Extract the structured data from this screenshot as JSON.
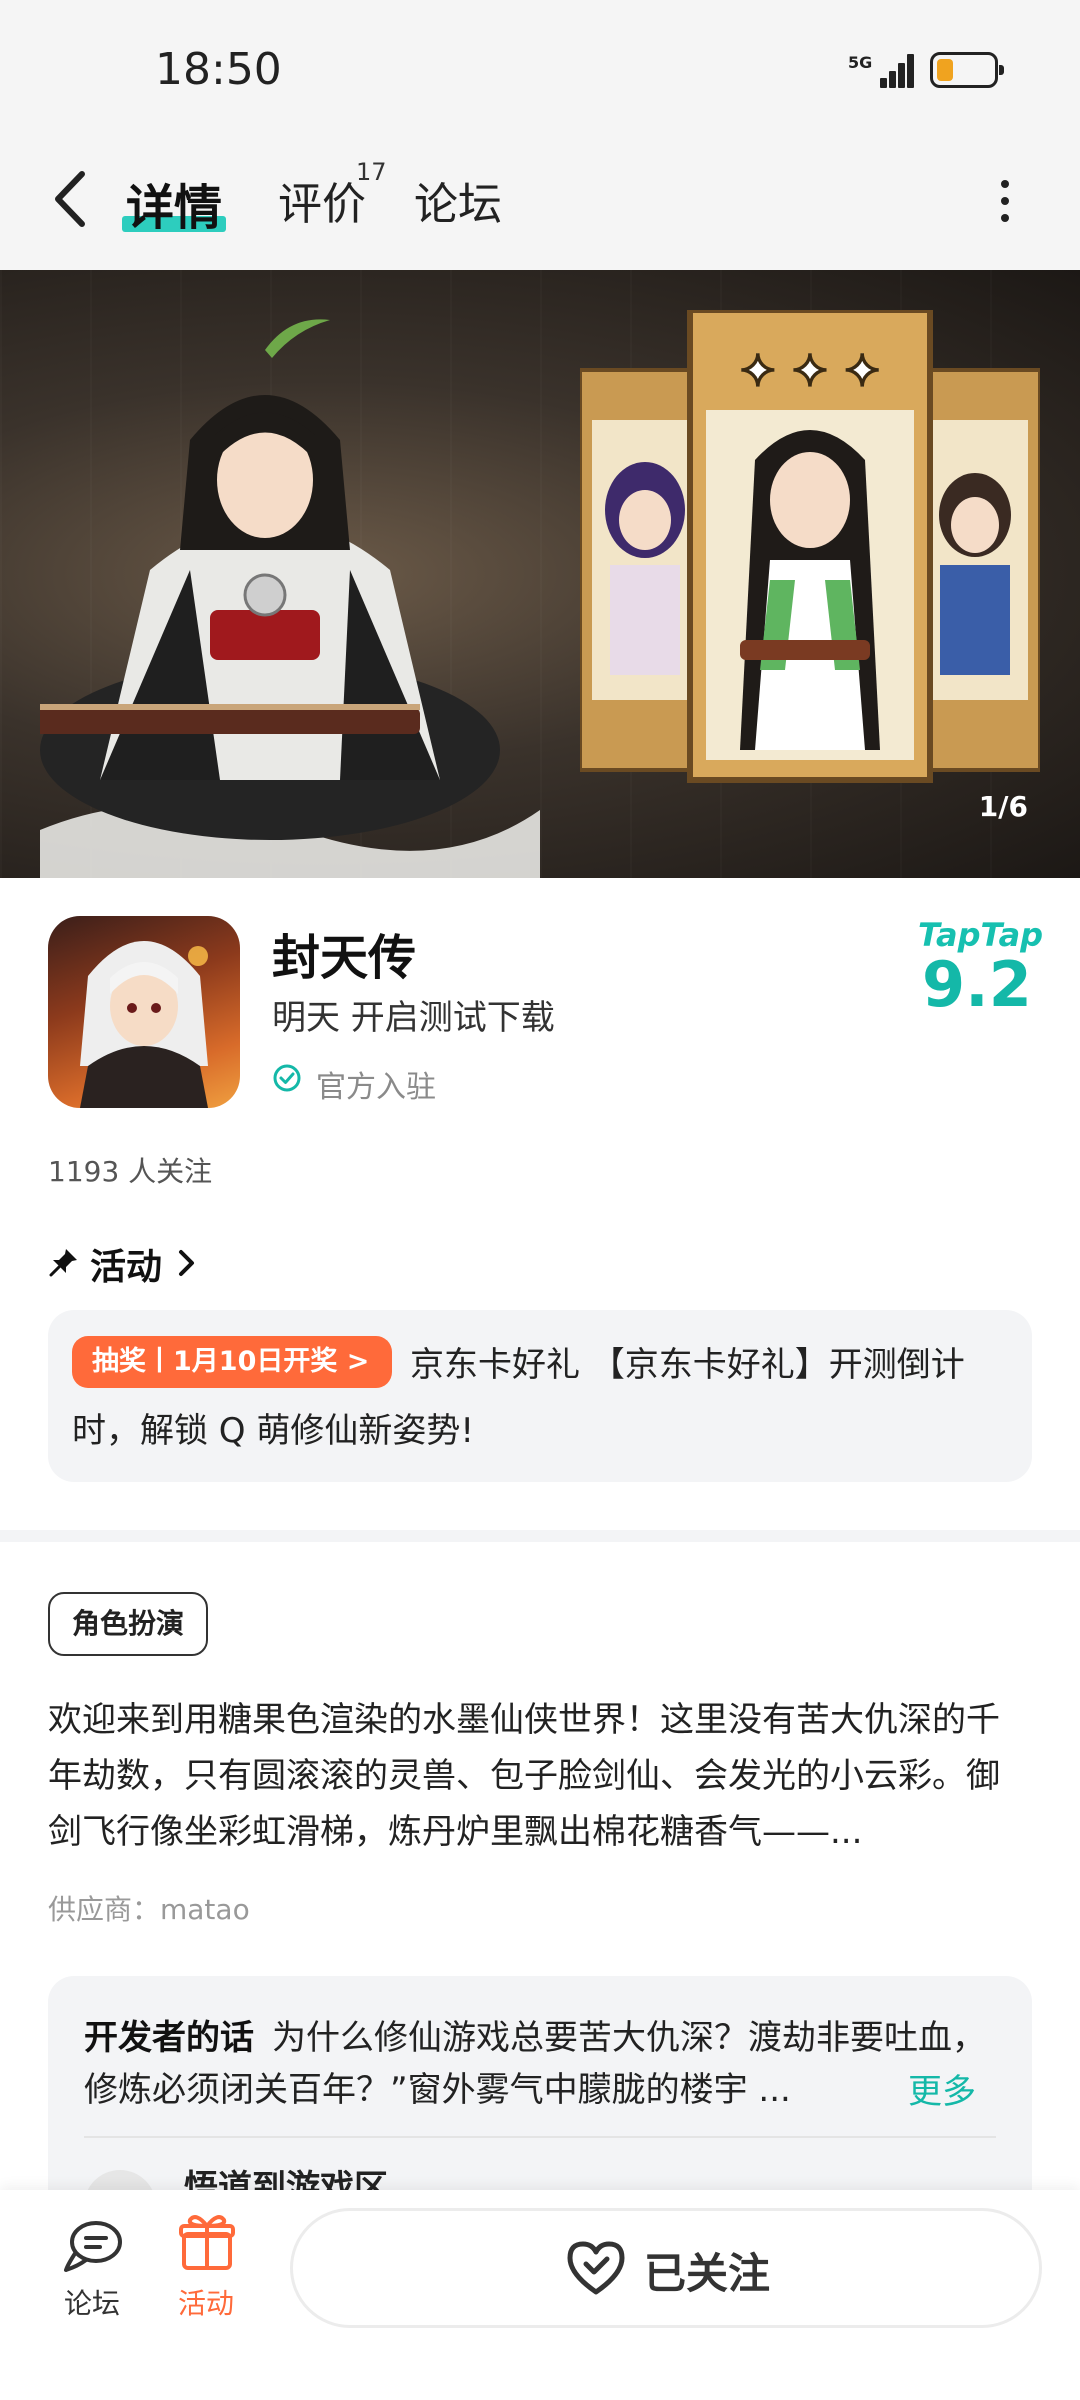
{
  "status_bar": {
    "time": "18:50",
    "network": "5G",
    "battery_level": 0.3
  },
  "top_nav": {
    "tabs": [
      {
        "label": "详情",
        "active": true
      },
      {
        "label": "评价",
        "badge": "17"
      },
      {
        "label": "论坛"
      }
    ]
  },
  "banner": {
    "counter": "1/6"
  },
  "game": {
    "title": "封天传",
    "subtitle": "明天 开启测试下载",
    "verified": "官方入驻",
    "rating_brand": "TapTap",
    "rating": "9.2",
    "followers": "1193 人关注"
  },
  "activity": {
    "section_title": "活动",
    "badge": "抽奖丨1月10日开奖 >",
    "text": "京东卡好礼 【京东卡好礼】开测倒计时，解锁 Q 萌修仙新姿势!"
  },
  "genre_tag": "角色扮演",
  "description": "欢迎来到用糖果色渲染的水墨仙侠世界！这里没有苦大仇深的千年劫数，只有圆滚滚的灵兽、包子脸剑仙、会发光的小云彩。御剑飞行像坐彩虹滑梯，炼丹炉里飘出棉花糖香气——...",
  "supplier": "供应商：matao",
  "developer_note": {
    "label": "开发者的话",
    "text": "为什么修仙游戏总要苦大仇深？渡劫非要吐血，修炼必须闭关百年？”窗外雾气中朦胧的楼宇 ...",
    "more": "更多",
    "sub_title": "悟道到游戏区"
  },
  "bottom_bar": {
    "forum_label": "论坛",
    "activity_label": "活动",
    "follow_label": "已关注"
  },
  "colors": {
    "accent_teal": "#14b8a8",
    "accent_orange": "#ff6a3a"
  }
}
